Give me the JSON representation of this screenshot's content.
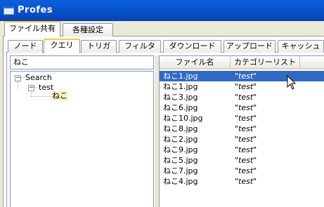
{
  "window": {
    "title": "Profes"
  },
  "outer_tabs": [
    {
      "label": "ファイル共有",
      "active": true
    },
    {
      "label": "各種設定",
      "active": false
    }
  ],
  "inner_tabs": [
    {
      "label": "ノード",
      "active": false
    },
    {
      "label": "クエリ",
      "active": true
    },
    {
      "label": "トリガ",
      "active": false
    },
    {
      "label": "フィルタ",
      "active": false
    },
    {
      "label": "ダウンロード",
      "active": false
    },
    {
      "label": "アップロード",
      "active": false
    },
    {
      "label": "キャッシュ",
      "active": false
    }
  ],
  "search": {
    "value": "ねこ"
  },
  "tree": {
    "root": {
      "label": "Search",
      "expander": "−"
    },
    "child": {
      "label": "test",
      "expander": "−"
    },
    "leaf": {
      "label": "ねこ"
    }
  },
  "list": {
    "columns": [
      "ファイル名",
      "カテゴリーリスト"
    ],
    "rows": [
      {
        "name": "ねこ1.jpg",
        "category": "\"test\""
      },
      {
        "name": "ねこ1.jpg",
        "category": "\"test\""
      },
      {
        "name": "ねこ3.jpg",
        "category": "\"test\""
      },
      {
        "name": "ねこ6.jpg",
        "category": "\"test\""
      },
      {
        "name": "ねこ10.jpg",
        "category": "\"test\""
      },
      {
        "name": "ねこ8.jpg",
        "category": "\"test\""
      },
      {
        "name": "ねこ2.jpg",
        "category": "\"test\""
      },
      {
        "name": "ねこ9.jpg",
        "category": "\"test\""
      },
      {
        "name": "ねこ5.jpg",
        "category": "\"test\""
      },
      {
        "name": "ねこ7.jpg",
        "category": "\"test\""
      },
      {
        "name": "ねこ4.jpg",
        "category": "\"test\""
      }
    ],
    "selected_index": 0
  },
  "colors": {
    "selection": "#316ac5",
    "titlebar": "#0a5fd8",
    "tab_highlight": "#ffc83c"
  },
  "icons": [
    "window-icon",
    "mouse-cursor-icon"
  ]
}
